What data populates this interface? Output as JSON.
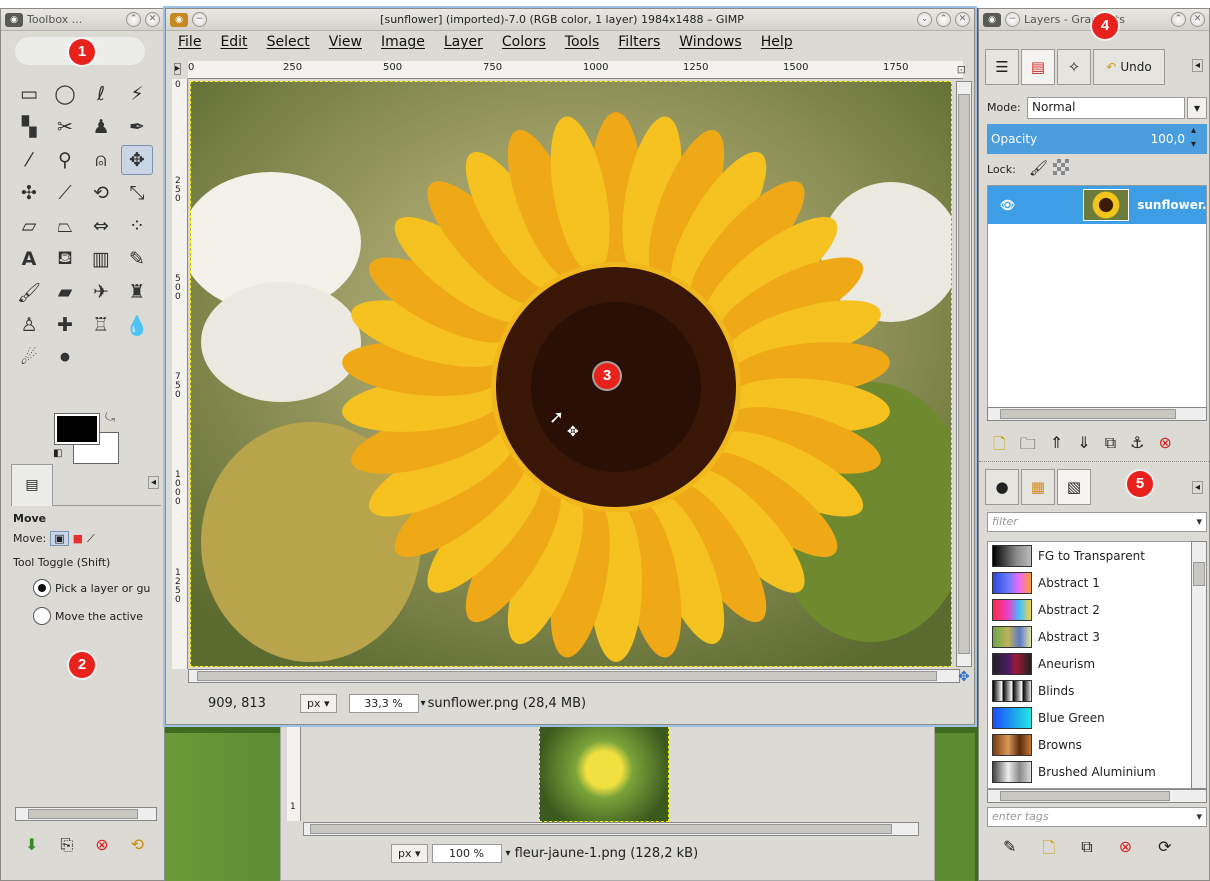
{
  "toolbox": {
    "title": "Toolbox ...",
    "badge": "1",
    "tools": [
      {
        "icon": "rect-select-icon",
        "glyph": "▭"
      },
      {
        "icon": "ellipse-select-icon",
        "glyph": "◯"
      },
      {
        "icon": "free-select-icon",
        "glyph": "ℓ"
      },
      {
        "icon": "fuzzy-select-icon",
        "glyph": "⚡"
      },
      {
        "icon": "color-select-icon",
        "glyph": "▚"
      },
      {
        "icon": "scissors-icon",
        "glyph": "✂"
      },
      {
        "icon": "foreground-select-icon",
        "glyph": "♟"
      },
      {
        "icon": "paths-icon",
        "glyph": "✒"
      },
      {
        "icon": "color-picker-icon",
        "glyph": "⁄"
      },
      {
        "icon": "zoom-icon",
        "glyph": "⚲"
      },
      {
        "icon": "measure-icon",
        "glyph": "⍝"
      },
      {
        "icon": "move-icon",
        "glyph": "✥"
      },
      {
        "icon": "align-icon",
        "glyph": "✣"
      },
      {
        "icon": "crop-icon",
        "glyph": "⟋"
      },
      {
        "icon": "rotate-icon",
        "glyph": "⟲"
      },
      {
        "icon": "scale-icon",
        "glyph": "⤡"
      },
      {
        "icon": "shear-icon",
        "glyph": "▱"
      },
      {
        "icon": "perspective-icon",
        "glyph": "⏢"
      },
      {
        "icon": "flip-icon",
        "glyph": "⇔"
      },
      {
        "icon": "cage-icon",
        "glyph": "⁘"
      },
      {
        "icon": "text-icon",
        "glyph": "A"
      },
      {
        "icon": "bucket-fill-icon",
        "glyph": "⛾"
      },
      {
        "icon": "blend-icon",
        "glyph": "▥"
      },
      {
        "icon": "pencil-icon",
        "glyph": "✎"
      },
      {
        "icon": "paintbrush-icon",
        "glyph": "🖌"
      },
      {
        "icon": "eraser-icon",
        "glyph": "▰"
      },
      {
        "icon": "airbrush-icon",
        "glyph": "✈"
      },
      {
        "icon": "ink-icon",
        "glyph": "♜"
      },
      {
        "icon": "clone-icon",
        "glyph": "♙"
      },
      {
        "icon": "heal-icon",
        "glyph": "✚"
      },
      {
        "icon": "perspective-clone-icon",
        "glyph": "♖"
      },
      {
        "icon": "blur-icon",
        "glyph": "💧"
      },
      {
        "icon": "smudge-icon",
        "glyph": "☄"
      },
      {
        "icon": "dodge-burn-icon",
        "glyph": "⚫"
      }
    ],
    "fg_color": "#000000",
    "bg_color": "#ffffff",
    "options": {
      "title": "Move",
      "move_label": "Move:",
      "toggle_label": "Tool Toggle  (Shift)",
      "radio1": "Pick a layer or gu",
      "radio2": "Move the active"
    },
    "badge2": "2"
  },
  "image": {
    "title": "[sunflower] (imported)-7.0 (RGB color, 1 layer) 1984x1488 – GIMP",
    "menu": [
      "File",
      "Edit",
      "Select",
      "View",
      "Image",
      "Layer",
      "Colors",
      "Tools",
      "Filters",
      "Windows",
      "Help"
    ],
    "hruler": [
      "0",
      "250",
      "500",
      "750",
      "1000",
      "1250",
      "1500",
      "1750"
    ],
    "vruler": [
      "0",
      "250",
      "500",
      "750",
      "1000",
      "1250"
    ],
    "badge": "3",
    "coords": "909, 813",
    "unit": "px",
    "zoom": "33,3 %",
    "file_info": "sunflower.png (28,4 MB)"
  },
  "image2": {
    "unit": "px",
    "zoom": "100 %",
    "file_info": "fleur-jaune-1.png (128,2 kB)",
    "vruler": [
      "1"
    ]
  },
  "layers": {
    "title": "Layers - Gradients",
    "badge": "4",
    "undo_label": "Undo",
    "mode_label": "Mode:",
    "mode_value": "Normal",
    "opacity_label": "Opacity",
    "opacity_value": "100,0",
    "lock_label": "Lock:",
    "layer_name": "sunflower.png",
    "badge2": "5",
    "filter_placeholder": "filter",
    "tags_placeholder": "enter tags",
    "gradients": [
      {
        "name": "FG to Transparent",
        "css": "linear-gradient(90deg,#000,#888 60%,#bbb)"
      },
      {
        "name": "Abstract 1",
        "css": "linear-gradient(90deg,#2b48d8,#6b7bff 40%,#f26af0 70%,#ff9a2f)"
      },
      {
        "name": "Abstract 2",
        "css": "linear-gradient(90deg,#ff2a4a,#e840c9 40%,#3ec3ff 70%,#ffd23a)"
      },
      {
        "name": "Abstract 3",
        "css": "linear-gradient(90deg,#6aa54a,#c0b35a 40%,#5a78c8 70%,#e4e4a0)"
      },
      {
        "name": "Aneurism",
        "css": "linear-gradient(90deg,#222,#4a1a66 40%,#a01a3a 60%,#222)"
      },
      {
        "name": "Blinds",
        "css": "repeating-linear-gradient(90deg,#000 0,#fff 9px,#000 10px)"
      },
      {
        "name": "Blue Green",
        "css": "linear-gradient(90deg,#1a4aff,#22e8e0)"
      },
      {
        "name": "Browns",
        "css": "linear-gradient(90deg,#7a3a10,#d99a5a 40%,#5a2a0a 70%,#c07a3a)"
      },
      {
        "name": "Brushed Aluminium",
        "css": "linear-gradient(90deg,#444,#eee 40%,#888 70%,#ddd)"
      }
    ]
  }
}
